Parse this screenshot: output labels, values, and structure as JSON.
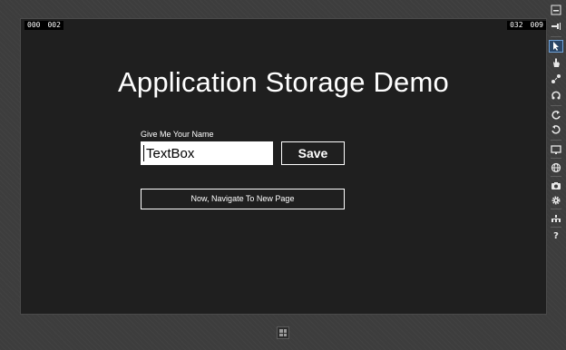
{
  "counters": {
    "left_a": "000",
    "left_b": "002",
    "right_a": "032",
    "right_b": "009"
  },
  "app": {
    "title": "Application Storage Demo",
    "name_label": "Give Me Your Name",
    "name_value": "TextBox",
    "save_label": "Save",
    "navigate_label": "Now, Navigate To New Page"
  },
  "toolbar": {
    "tools": [
      "minimize",
      "pin",
      "pointer",
      "touch",
      "pinch",
      "rotate",
      "rotate-cw",
      "rotate-ccw",
      "resolution",
      "location",
      "screenshot",
      "settings",
      "network",
      "help"
    ],
    "help_glyph": "?"
  }
}
